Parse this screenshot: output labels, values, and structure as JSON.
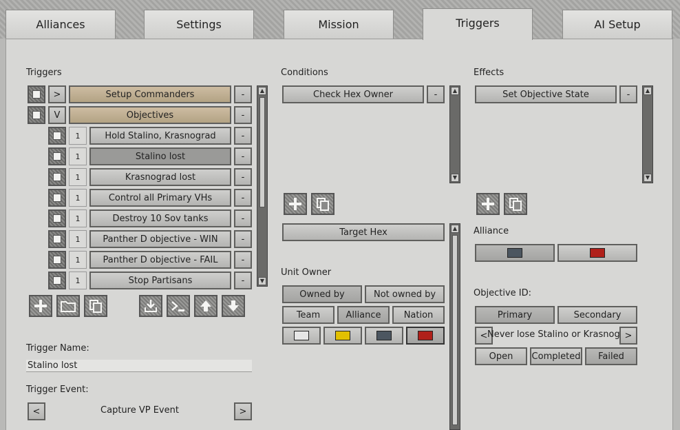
{
  "tabs": [
    {
      "label": "Alliances"
    },
    {
      "label": "Settings"
    },
    {
      "label": "Mission"
    },
    {
      "label": "Triggers"
    },
    {
      "label": "AI Setup"
    }
  ],
  "active_tab": "Triggers",
  "triggers": {
    "heading": "Triggers",
    "groups": [
      {
        "toggle": ">",
        "label": "Setup Commanders"
      },
      {
        "toggle": "V",
        "label": "Objectives"
      }
    ],
    "items": [
      {
        "num": "1",
        "label": "Hold Stalino, Krasnograd"
      },
      {
        "num": "1",
        "label": "Stalino lost"
      },
      {
        "num": "1",
        "label": "Krasnograd lost"
      },
      {
        "num": "1",
        "label": "Control all Primary VHs"
      },
      {
        "num": "1",
        "label": "Destroy 10 Sov tanks"
      },
      {
        "num": "1",
        "label": "Panther D  objective - WIN"
      },
      {
        "num": "1",
        "label": "Panther D  objective - FAIL"
      },
      {
        "num": "1",
        "label": "Stop Partisans"
      }
    ],
    "remove_label": "-",
    "name_label": "Trigger Name:",
    "name_value": "Stalino lost",
    "event_label": "Trigger Event:",
    "event_value": "Capture VP Event",
    "prev": "<",
    "next": ">"
  },
  "conditions": {
    "heading": "Conditions",
    "items": [
      {
        "label": "Check Hex Owner"
      }
    ],
    "remove_label": "-",
    "target_hex": "Target Hex",
    "unit_owner_label": "Unit Owner",
    "owned_by": "Owned by",
    "not_owned_by": "Not owned by",
    "team": "Team",
    "alliance": "Alliance",
    "nation": "Nation",
    "swatches": [
      "#e6e6e6",
      "#e2c000",
      "#4c5660",
      "#b0201a"
    ]
  },
  "effects": {
    "heading": "Effects",
    "items": [
      {
        "label": "Set Objective State"
      }
    ],
    "remove_label": "-",
    "alliance_label": "Alliance",
    "alliance_swatches": [
      "#4c5660",
      "#b0201a"
    ],
    "objective_id_label": "Objective ID:",
    "primary": "Primary",
    "secondary": "Secondary",
    "objective_value": "Never lose Stalino or Krasnograd",
    "prev": "<",
    "next": ">",
    "open": "Open",
    "completed": "Completed",
    "failed": "Failed"
  }
}
